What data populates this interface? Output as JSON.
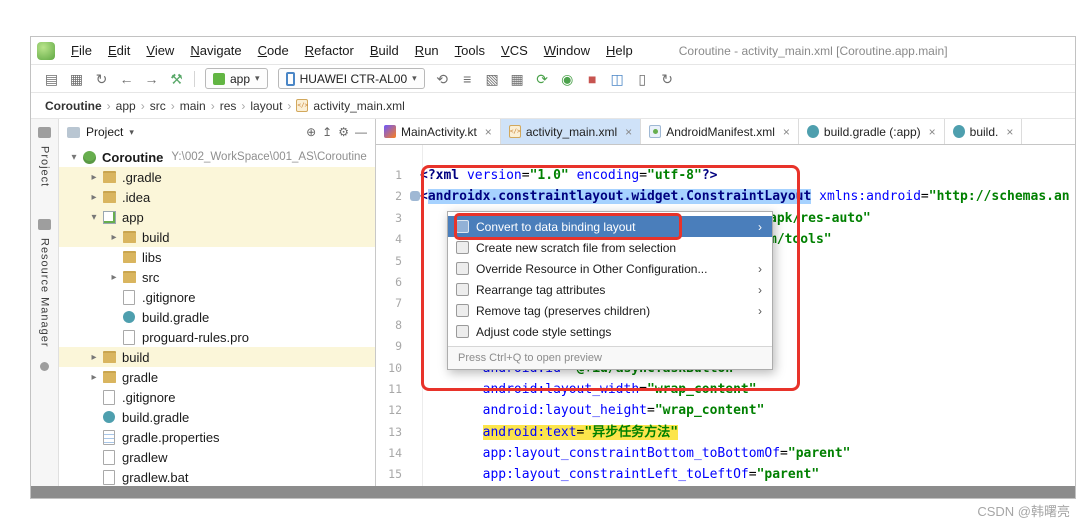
{
  "window": {
    "title": "Coroutine - activity_main.xml [Coroutine.app.main]"
  },
  "menubar": [
    "File",
    "Edit",
    "View",
    "Navigate",
    "Code",
    "Refactor",
    "Build",
    "Run",
    "Tools",
    "VCS",
    "Window",
    "Help"
  ],
  "toolbar": {
    "left_icons": [
      {
        "name": "open-icon",
        "glyph": "▤",
        "color": "#6E6E6E"
      },
      {
        "name": "save-all-icon",
        "glyph": "▦",
        "color": "#6E6E6E"
      },
      {
        "name": "sync-icon",
        "glyph": "↻",
        "color": "#6E6E6E"
      },
      {
        "name": "back-icon",
        "glyph": "←",
        "color": "#6E6E6E"
      },
      {
        "name": "forward-icon",
        "glyph": "→",
        "color": "#6E6E6E"
      },
      {
        "name": "build-hammer-icon",
        "glyph": "⚒",
        "color": "#59A869"
      }
    ],
    "app_selector": {
      "label": "app"
    },
    "device_selector": {
      "label": "HUAWEI CTR-AL00"
    },
    "right_icons": [
      {
        "name": "sync-project-icon",
        "glyph": "⟲",
        "color": "#6E6E6E"
      },
      {
        "name": "build-variants-icon",
        "glyph": "≡",
        "color": "#6E6E6E"
      },
      {
        "name": "profiler-icon",
        "glyph": "▧",
        "color": "#6E6E6E"
      },
      {
        "name": "inspect-icon",
        "glyph": "▦",
        "color": "#6E6E6E"
      },
      {
        "name": "run-icon",
        "glyph": "⟳",
        "color": "#4CA24C"
      },
      {
        "name": "debug-icon",
        "glyph": "◉",
        "color": "#4CA24C"
      },
      {
        "name": "stop-icon",
        "glyph": "■",
        "color": "#C75450"
      },
      {
        "name": "capture-icon",
        "glyph": "◫",
        "color": "#4A86C6"
      },
      {
        "name": "device-manager-icon",
        "glyph": "▯",
        "color": "#6E6E6E"
      },
      {
        "name": "attach-debugger-icon",
        "glyph": "↻",
        "color": "#6E6E6E"
      }
    ]
  },
  "breadcrumb": [
    "Coroutine",
    "app",
    "src",
    "main",
    "res",
    "layout",
    "activity_main.xml"
  ],
  "tool_strip": {
    "top": "Project",
    "bottom": "Resource Manager"
  },
  "project_panel": {
    "title": "Project",
    "tree": [
      {
        "label": "Coroutine",
        "suffix": "Y:\\002_WorkSpace\\001_AS\\Coroutine",
        "depth": 0,
        "chevron": "open",
        "icon": "android",
        "bold": true
      },
      {
        "label": ".gradle",
        "depth": 1,
        "chevron": "closed",
        "icon": "folder",
        "hl": true
      },
      {
        "label": ".idea",
        "depth": 1,
        "chevron": "closed",
        "icon": "folder",
        "hl": true
      },
      {
        "label": "app",
        "depth": 1,
        "chevron": "open",
        "icon": "module",
        "hl": true
      },
      {
        "label": "build",
        "depth": 2,
        "chevron": "closed",
        "icon": "folder",
        "hl": true
      },
      {
        "label": "libs",
        "depth": 2,
        "chevron": "none",
        "icon": "folder"
      },
      {
        "label": "src",
        "depth": 2,
        "chevron": "closed",
        "icon": "folder"
      },
      {
        "label": ".gitignore",
        "depth": 2,
        "chevron": "none",
        "icon": "file"
      },
      {
        "label": "build.gradle",
        "depth": 2,
        "chevron": "none",
        "icon": "gradle"
      },
      {
        "label": "proguard-rules.pro",
        "depth": 2,
        "chevron": "none",
        "icon": "file"
      },
      {
        "label": "build",
        "depth": 1,
        "chevron": "closed",
        "icon": "folder",
        "hl": true
      },
      {
        "label": "gradle",
        "depth": 1,
        "chevron": "closed",
        "icon": "folder"
      },
      {
        "label": ".gitignore",
        "depth": 1,
        "chevron": "none",
        "icon": "file"
      },
      {
        "label": "build.gradle",
        "depth": 1,
        "chevron": "none",
        "icon": "gradle"
      },
      {
        "label": "gradle.properties",
        "depth": 1,
        "chevron": "none",
        "icon": "props"
      },
      {
        "label": "gradlew",
        "depth": 1,
        "chevron": "none",
        "icon": "file"
      },
      {
        "label": "gradlew.bat",
        "depth": 1,
        "chevron": "none",
        "icon": "file"
      }
    ]
  },
  "editor": {
    "tabs": [
      {
        "label": "MainActivity.kt",
        "icon": "kotlin",
        "active": false
      },
      {
        "label": "activity_main.xml",
        "icon": "xml",
        "active": true
      },
      {
        "label": "AndroidManifest.xml",
        "icon": "manifest",
        "active": false
      },
      {
        "label": "build.gradle (:app)",
        "icon": "gradle",
        "active": false
      },
      {
        "label": "build.",
        "icon": "gradle",
        "active": false
      }
    ],
    "lines": [
      {
        "n": 1,
        "segs": [
          {
            "t": "<?xml",
            "c": "tag"
          },
          {
            "t": " ",
            "c": "plain"
          },
          {
            "t": "version",
            "c": "attr"
          },
          {
            "t": "=",
            "c": "plain"
          },
          {
            "t": "\"1.0\"",
            "c": "val"
          },
          {
            "t": " ",
            "c": "plain"
          },
          {
            "t": "encoding",
            "c": "attr"
          },
          {
            "t": "=",
            "c": "plain"
          },
          {
            "t": "\"utf-8\"",
            "c": "val"
          },
          {
            "t": "?>",
            "c": "tag"
          }
        ]
      },
      {
        "n": 2,
        "marker": true,
        "segs": [
          {
            "t": "<",
            "c": "tag"
          },
          {
            "t": "androidx.constraintlayout.widget.ConstraintLayout",
            "c": "tag",
            "bg": "sel"
          },
          {
            "t": " ",
            "c": "plain"
          },
          {
            "t": "xmlns:android",
            "c": "attr"
          },
          {
            "t": "=",
            "c": "plain"
          },
          {
            "t": "\"http://schemas.an",
            "c": "val"
          }
        ]
      },
      {
        "n": 3,
        "pad": 357,
        "segs": [
          {
            "t": "apk/res-auto\"",
            "c": "val"
          }
        ]
      },
      {
        "n": 4,
        "pad": 357,
        "segs": [
          {
            "t": "m/tools\"",
            "c": "val"
          }
        ]
      },
      {
        "n": 5,
        "segs": []
      },
      {
        "n": 6,
        "segs": []
      },
      {
        "n": 7,
        "segs": []
      },
      {
        "n": 8,
        "segs": []
      },
      {
        "n": 9,
        "segs": []
      },
      {
        "n": 10,
        "segs": [
          {
            "t": "        ",
            "c": "plain"
          },
          {
            "t": "android:id",
            "c": "attr"
          },
          {
            "t": "=",
            "c": "plain"
          },
          {
            "t": "\"@+id/asyncTaskButton\"",
            "c": "val"
          }
        ]
      },
      {
        "n": 11,
        "segs": [
          {
            "t": "        ",
            "c": "plain"
          },
          {
            "t": "android:layout_width",
            "c": "attr"
          },
          {
            "t": "=",
            "c": "plain"
          },
          {
            "t": "\"wrap_content\"",
            "c": "val"
          }
        ]
      },
      {
        "n": 12,
        "segs": [
          {
            "t": "        ",
            "c": "plain"
          },
          {
            "t": "android:layout_height",
            "c": "attr"
          },
          {
            "t": "=",
            "c": "plain"
          },
          {
            "t": "\"wrap_content\"",
            "c": "val"
          }
        ]
      },
      {
        "n": 13,
        "segs": [
          {
            "t": "        ",
            "c": "plain"
          },
          {
            "t": "android:text",
            "c": "attr",
            "bg": "find"
          },
          {
            "t": "=",
            "c": "plain",
            "bg": "find"
          },
          {
            "t": "\"异步任务方法\"",
            "c": "val",
            "bg": "find"
          }
        ]
      },
      {
        "n": 14,
        "segs": [
          {
            "t": "        ",
            "c": "plain"
          },
          {
            "t": "app:layout_constraintBottom_toBottomOf",
            "c": "attr"
          },
          {
            "t": "=",
            "c": "plain"
          },
          {
            "t": "\"parent\"",
            "c": "val"
          }
        ]
      },
      {
        "n": 15,
        "segs": [
          {
            "t": "        ",
            "c": "plain"
          },
          {
            "t": "app:layout_constraintLeft_toLeftOf",
            "c": "attr"
          },
          {
            "t": "=",
            "c": "plain"
          },
          {
            "t": "\"parent\"",
            "c": "val"
          }
        ]
      }
    ]
  },
  "context_menu": {
    "items": [
      {
        "label": "Convert to data binding layout",
        "selected": true,
        "submenu": true
      },
      {
        "label": "Create new scratch file from selection",
        "submenu": false
      },
      {
        "label": "Override Resource in Other Configuration...",
        "submenu": true
      },
      {
        "label": "Rearrange tag attributes",
        "submenu": true
      },
      {
        "label": "Remove tag (preserves children)",
        "submenu": true
      },
      {
        "label": "Adjust code style settings",
        "submenu": false
      }
    ],
    "footer": "Press Ctrl+Q to open preview"
  },
  "watermark": "CSDN @韩曙亮",
  "colors": {
    "annotation_red": "#E8332A",
    "selection_blue": "#A6D2FF",
    "find_yellow": "#FCE54B",
    "menu_selection": "#4A7EBB",
    "xml_tag": "#000080",
    "xml_attr": "#0000FF",
    "xml_value": "#008000",
    "hl_row": "#FBF6D9",
    "run_green": "#4CA24C",
    "stop_red": "#C75450"
  }
}
